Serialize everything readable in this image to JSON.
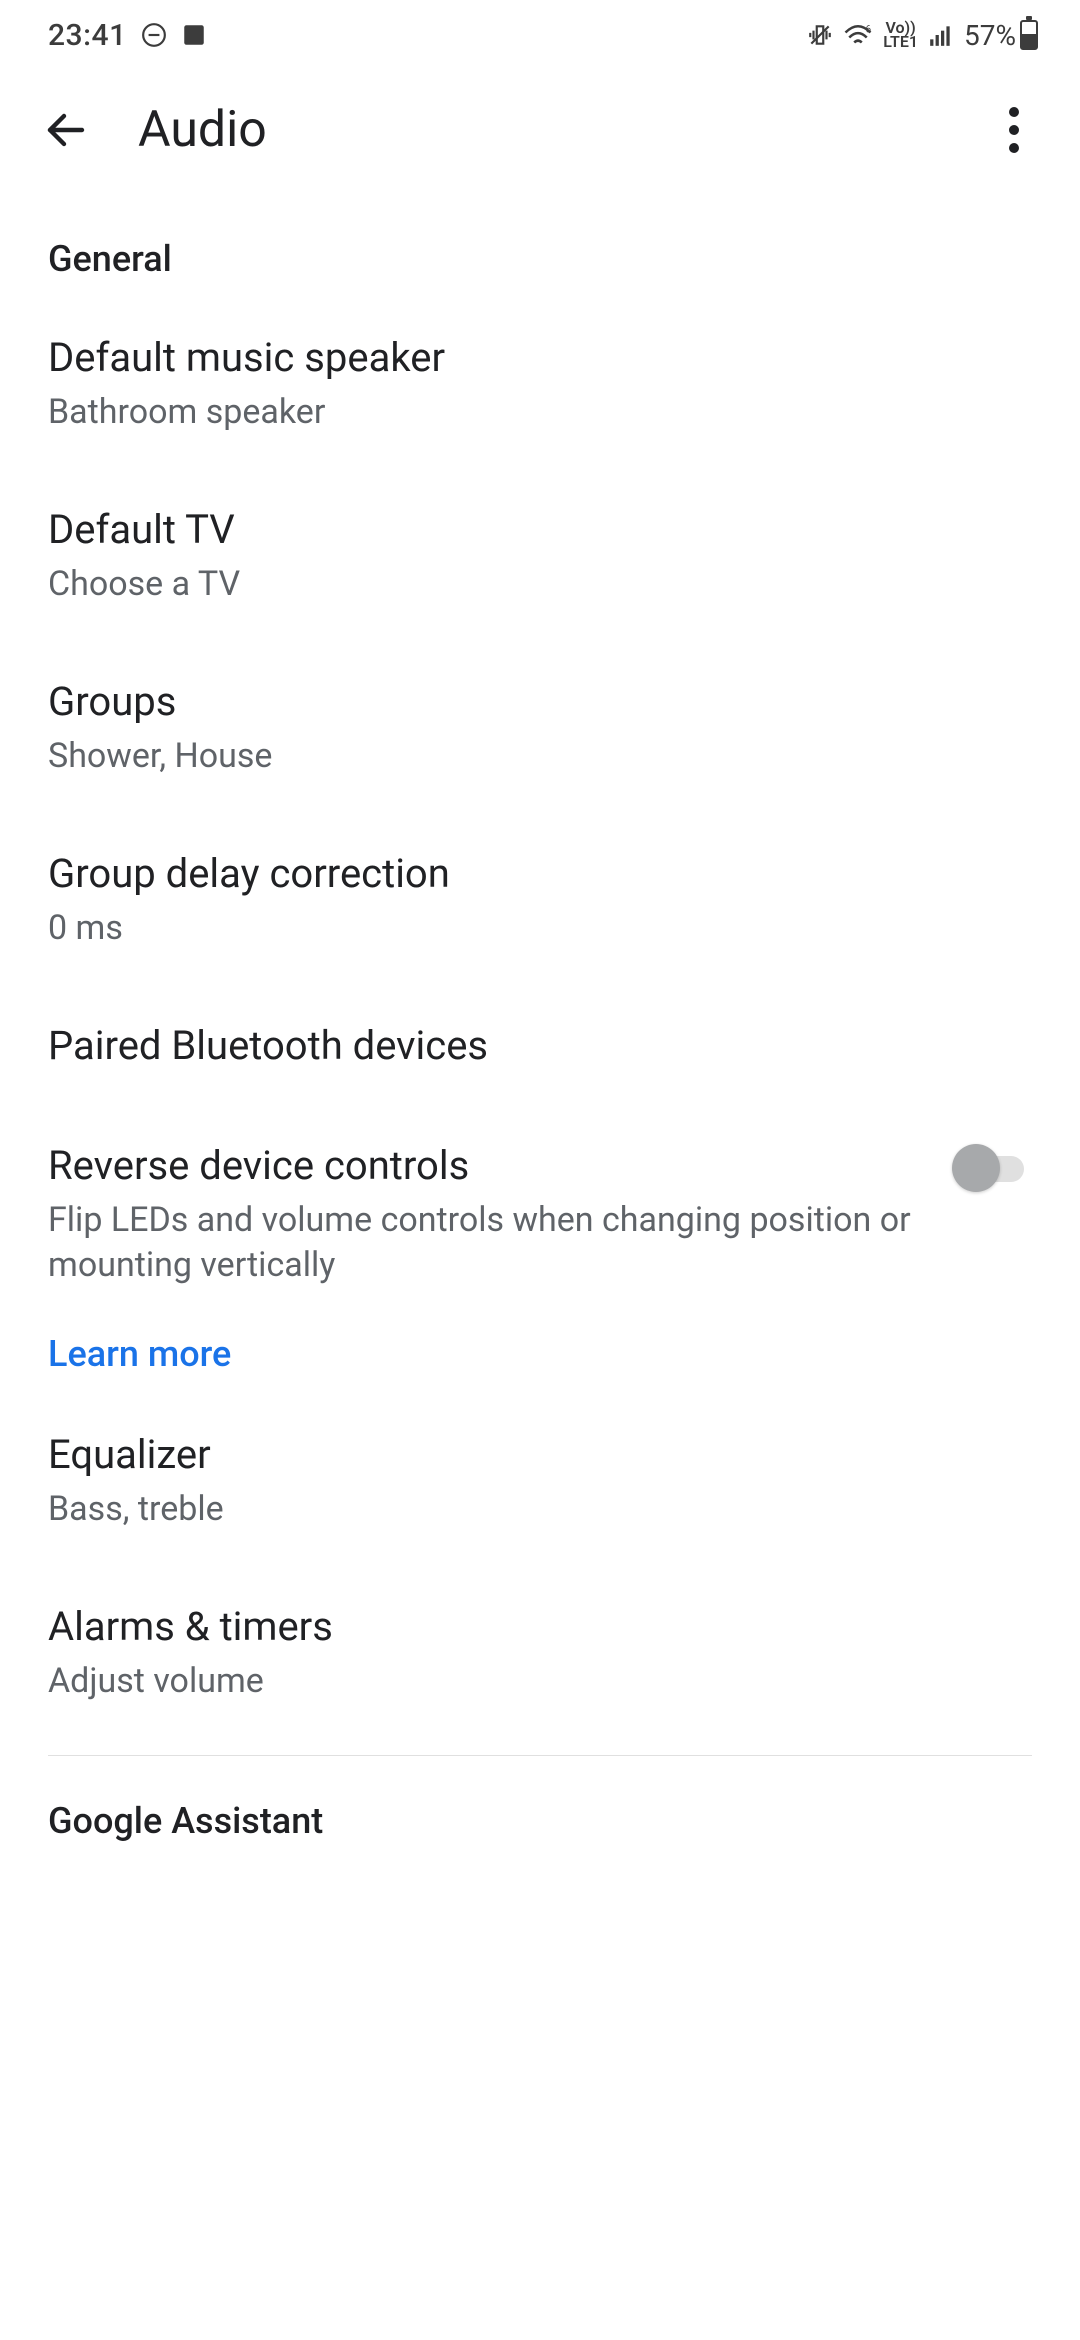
{
  "status": {
    "time": "23:41",
    "battery_pct": "57%",
    "lte_top": "Vo))",
    "lte_bottom": "LTE1"
  },
  "header": {
    "title": "Audio"
  },
  "sections": {
    "general": "General",
    "google_assistant": "Google Assistant"
  },
  "items": {
    "default_speaker": {
      "title": "Default music speaker",
      "sub": "Bathroom speaker"
    },
    "default_tv": {
      "title": "Default TV",
      "sub": "Choose a TV"
    },
    "groups": {
      "title": "Groups",
      "sub": "Shower, House"
    },
    "group_delay": {
      "title": "Group delay correction",
      "sub": "0 ms"
    },
    "paired_bt": {
      "title": "Paired Bluetooth devices"
    },
    "reverse_controls": {
      "title": "Reverse device controls",
      "sub": "Flip LEDs and volume controls when changing position or mounting vertically",
      "enabled": false
    },
    "learn_more": "Learn more",
    "equalizer": {
      "title": "Equalizer",
      "sub": "Bass, treble"
    },
    "alarms": {
      "title": "Alarms & timers",
      "sub": "Adjust volume"
    }
  }
}
